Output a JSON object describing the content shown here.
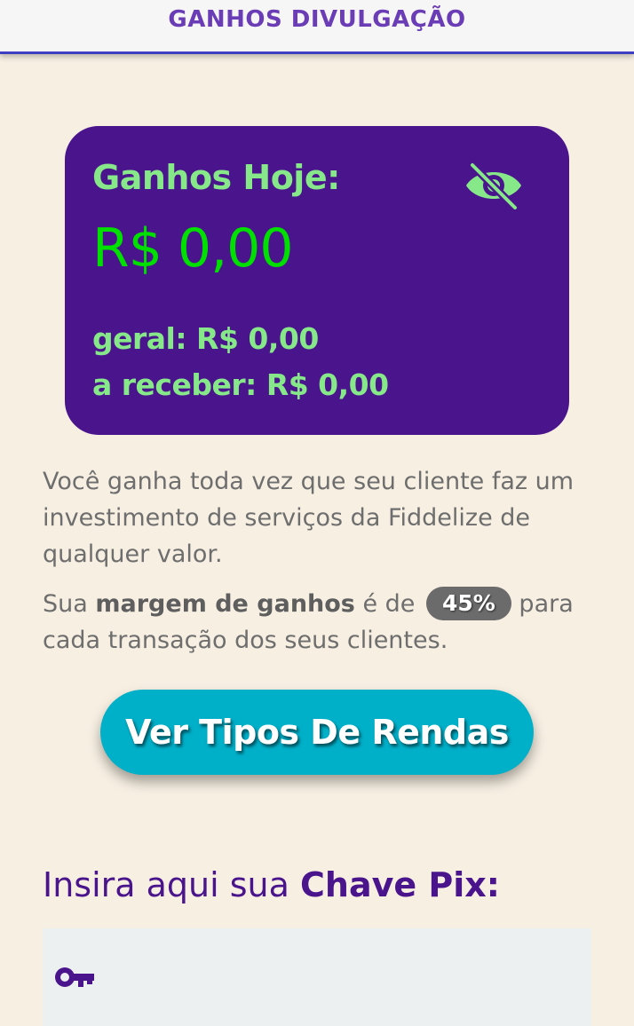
{
  "header": {
    "title": "GANHOS DIVULGAÇÃO"
  },
  "earnings_card": {
    "today_label": "Ganhos Hoje:",
    "today_amount": "R$ 0,00",
    "general_label": "geral: R$ 0,00",
    "receivable_label": "a receber: R$ 0,00",
    "visibility_icon": "eye-slash-icon"
  },
  "description": {
    "paragraph1": "Você ganha toda vez que seu cliente faz um investimento de serviços da Fiddelize de qualquer valor.",
    "margin_prefix": "Sua ",
    "margin_bold": "margem de ganhos",
    "margin_middle": " é de ",
    "margin_value": "45%",
    "margin_suffix": " para cada transação dos seus clientes."
  },
  "cta": {
    "label": "Ver Tipos De Rendas"
  },
  "pix": {
    "title_prefix": "Insira aqui sua ",
    "title_bold": "Chave Pix:",
    "input_value": "",
    "icon": "key-icon"
  },
  "colors": {
    "background": "#f7efe2",
    "card": "#4a148c",
    "accent_green": "#86e889",
    "amount_green": "#00e000",
    "cta": "#00afc8",
    "header_text": "#6a3cb5"
  }
}
